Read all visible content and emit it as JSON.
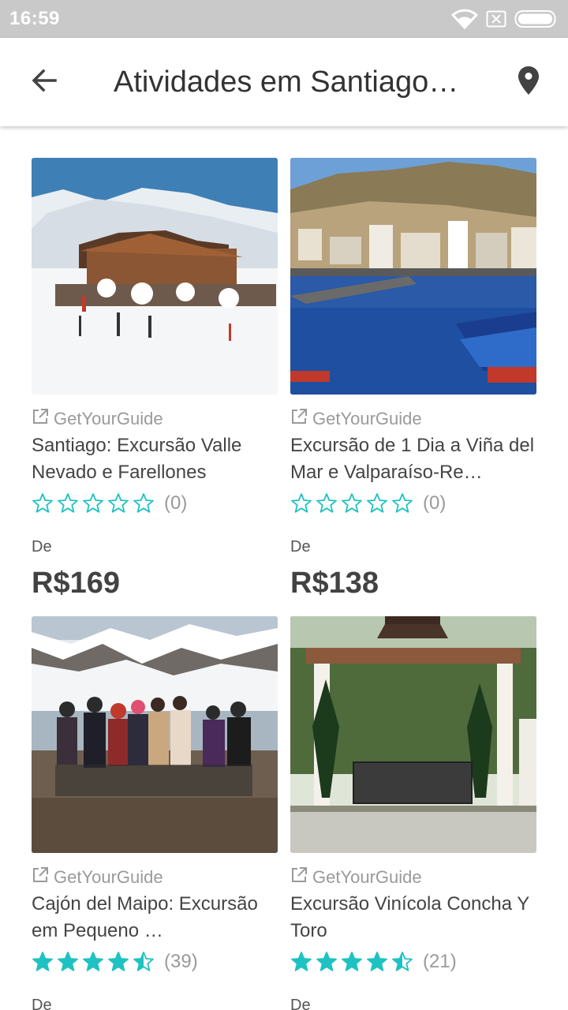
{
  "status_bar": {
    "time": "16:59"
  },
  "app_bar": {
    "title": "Atividades em Santiago…"
  },
  "cards": [
    {
      "provider": "GetYourGuide",
      "title": "Santiago: Excursão Valle Nevado e Farellones",
      "rating": 0,
      "review_count": "(0)",
      "from_label": "De",
      "price": "R$169"
    },
    {
      "provider": "GetYourGuide",
      "title": "Excursão de 1 Dia a Viña del Mar e Valparaíso-Re…",
      "rating": 0,
      "review_count": "(0)",
      "from_label": "De",
      "price": "R$138"
    },
    {
      "provider": "GetYourGuide",
      "title": "Cajón del Maipo: Excursão em Pequeno …",
      "rating": 4.5,
      "review_count": "(39)",
      "from_label": "De",
      "price": ""
    },
    {
      "provider": "GetYourGuide",
      "title": "Excursão Vinícola Concha Y Toro",
      "rating": 4.5,
      "review_count": "(21)",
      "from_label": "De",
      "price": ""
    }
  ],
  "colors": {
    "star": "#1ec2c2",
    "status_bar": "#c9c9c9"
  }
}
